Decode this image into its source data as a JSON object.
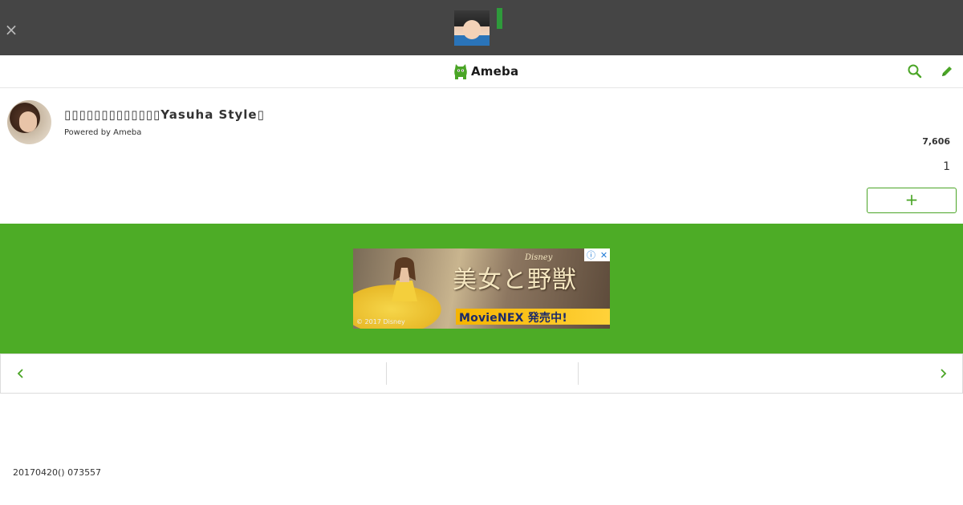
{
  "topbar": {
    "close_label": "×"
  },
  "appbar": {
    "logo_text": "Ameba",
    "brand_color": "#4aa526",
    "search_icon": "search-icon",
    "edit_icon": "pencil-icon"
  },
  "header": {
    "blog_title": "▯▯▯▯▯▯▯▯▯▯▯▯▯Yasuha Style▯",
    "powered_by": "Powered by Ameba",
    "count_primary": "7,606",
    "count_secondary": "1",
    "follow_label": "+"
  },
  "ad": {
    "title": "美女と野獣",
    "brand": "Disney",
    "strip": "MovieNEX 発売中!",
    "copyright": "© 2017 Disney",
    "badge_info": "ⓘ",
    "badge_close": "✕",
    "band_color": "#4dac26"
  },
  "post": {
    "date_line": "20170420() 073557"
  }
}
